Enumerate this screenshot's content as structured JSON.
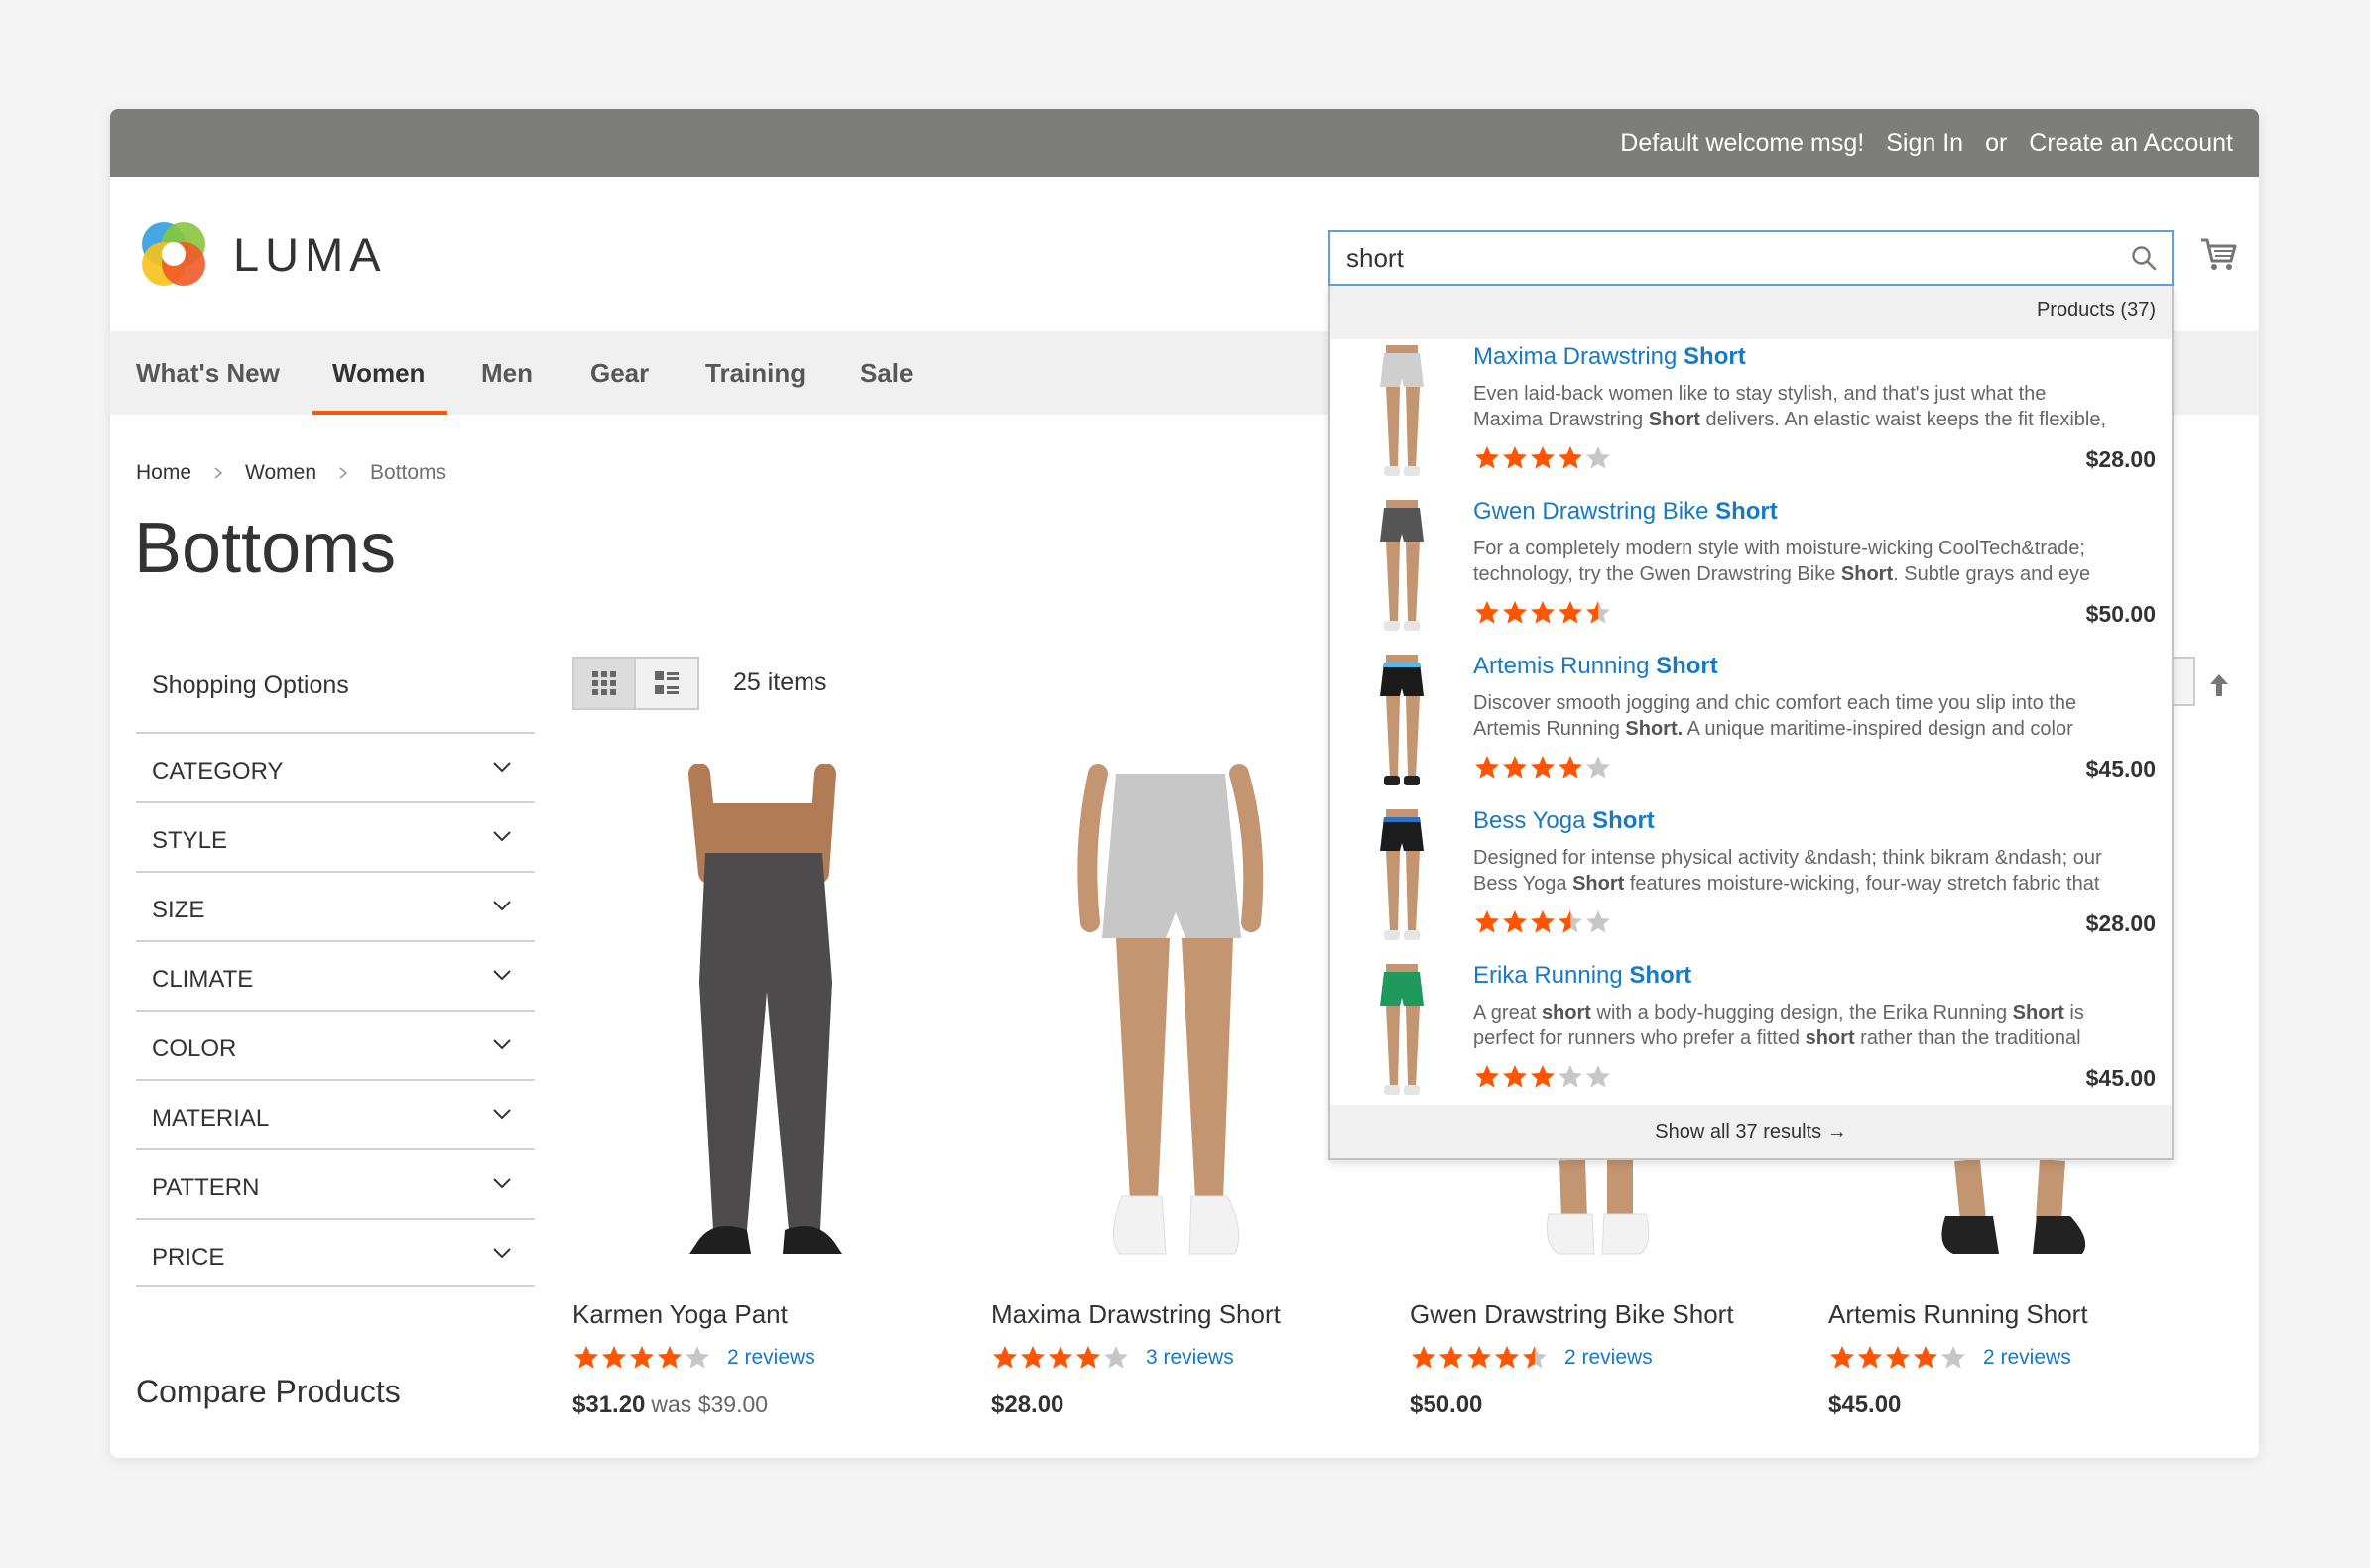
{
  "topbar": {
    "welcome": "Default welcome msg!",
    "sign_in": "Sign In",
    "or": "or",
    "create_account": "Create an Account"
  },
  "logo": {
    "wordmark": "LUMA"
  },
  "search": {
    "value": "short"
  },
  "nav": [
    "What's New",
    "Women",
    "Men",
    "Gear",
    "Training",
    "Sale"
  ],
  "breadcrumb": [
    "Home",
    "Women",
    "Bottoms"
  ],
  "page_title": "Bottoms",
  "sidebar": {
    "title": "Shopping Options",
    "filters": [
      "CATEGORY",
      "STYLE",
      "SIZE",
      "CLIMATE",
      "COLOR",
      "MATERIAL",
      "PATTERN",
      "PRICE"
    ],
    "compare_title": "Compare Products"
  },
  "toolbar": {
    "items_count": "25 items"
  },
  "products": [
    {
      "name": "Karmen Yoga Pant",
      "rating": 4,
      "reviews": "2 reviews",
      "price": "$31.20",
      "was": "was $39.00"
    },
    {
      "name": "Maxima Drawstring Short",
      "rating": 4,
      "reviews": "3 reviews",
      "price": "$28.00"
    },
    {
      "name": "Gwen Drawstring Bike Short",
      "rating": 4.5,
      "reviews": "2 reviews",
      "price": "$50.00"
    },
    {
      "name": "Artemis Running Short",
      "rating": 4,
      "reviews": "2 reviews",
      "price": "$45.00"
    }
  ],
  "autocomplete": {
    "header": "Products (37)",
    "footer": "Show all 37 results →",
    "items": [
      {
        "title_pre": "Maxima Drawstring ",
        "title_bold": "Short",
        "line1": "Even laid-back women like to stay stylish, and that's just what the",
        "line2_pre": "Maxima Drawstring ",
        "line2_bold": "Short",
        "line2_post": " delivers. An elastic waist keeps the fit flexible,",
        "rating": 4,
        "price": "$28.00",
        "shorts_color": "#cfcfcf",
        "band_color": "#cfcfcf"
      },
      {
        "title_pre": "Gwen Drawstring Bike ",
        "title_bold": "Short",
        "line1": "For a completely modern style with moisture-wicking CoolTech&trade;",
        "line2_pre": "technology, try the Gwen Drawstring Bike ",
        "line2_bold": "Short",
        "line2_post": ". Subtle grays and eye",
        "rating": 4.5,
        "price": "$50.00",
        "shorts_color": "#555555",
        "band_color": "#555555"
      },
      {
        "title_pre": "Artemis Running ",
        "title_bold": "Short",
        "line1": "Discover smooth jogging and chic comfort each time you slip into the",
        "line2_pre": "Artemis Running ",
        "line2_bold": "Short.",
        "line2_post": " A unique maritime-inspired design and color",
        "rating": 4,
        "price": "$45.00",
        "shorts_color": "#1a1a1a",
        "band_color": "#5ab7e0"
      },
      {
        "title_pre": "Bess Yoga ",
        "title_bold": "Short",
        "line1": "Designed for intense physical activity &ndash; think bikram &ndash; our",
        "line2_pre": "Bess Yoga ",
        "line2_bold": "Short",
        "line2_post": " features moisture-wicking, four-way stretch fabric that",
        "rating": 3.5,
        "price": "$28.00",
        "shorts_color": "#1c1c1c",
        "band_color": "#2e6fc2"
      },
      {
        "title_pre": "Erika Running ",
        "title_bold": "Short",
        "line1_pre": "A great ",
        "line1_bold": "short",
        "line1_post": " with a body-hugging design, the Erika Running ",
        "line1_bold2": "Short",
        "line1_post2": " is",
        "line2_pre": "perfect for runners who prefer a fitted ",
        "line2_bold": "short",
        "line2_post": " rather than the traditional",
        "rating": 3,
        "price": "$45.00",
        "shorts_color": "#1f9a5c",
        "band_color": "#1f9a5c"
      }
    ]
  },
  "colors": {
    "accent": "#ff5501",
    "link": "#1979c3",
    "topbar": "#7d7d7b"
  }
}
